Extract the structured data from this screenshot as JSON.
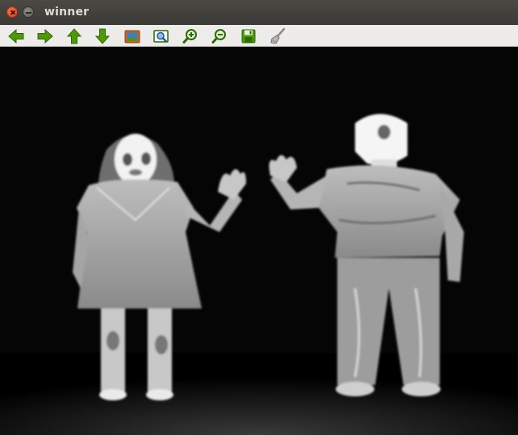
{
  "window": {
    "title": "winner"
  },
  "toolbar": {
    "items": [
      {
        "name": "pan-left",
        "icon": "arrow-left-icon"
      },
      {
        "name": "pan-right",
        "icon": "arrow-right-icon"
      },
      {
        "name": "pan-up",
        "icon": "arrow-up-icon"
      },
      {
        "name": "pan-down",
        "icon": "arrow-down-icon"
      },
      {
        "name": "zoom-original",
        "icon": "image-icon"
      },
      {
        "name": "zoom-fit",
        "icon": "zoom-image-icon"
      },
      {
        "name": "zoom-in",
        "icon": "zoom-in-icon"
      },
      {
        "name": "zoom-out",
        "icon": "zoom-out-icon"
      },
      {
        "name": "save",
        "icon": "save-icon"
      },
      {
        "name": "properties",
        "icon": "brush-icon"
      }
    ]
  },
  "image": {
    "description_icon": "thermal-image",
    "palette": {
      "background": "#000000",
      "figure": "#9a9a9a",
      "hot": "#f5f5f5"
    }
  }
}
